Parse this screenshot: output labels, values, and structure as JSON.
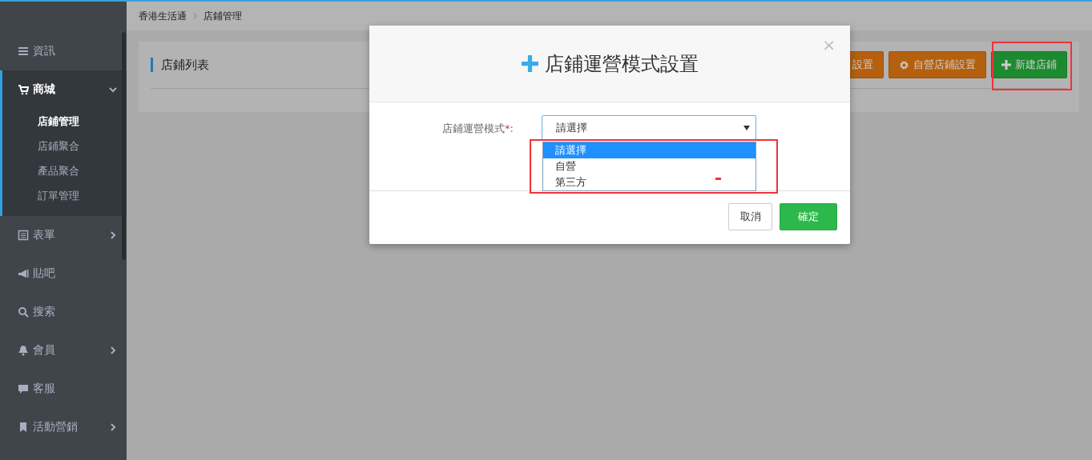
{
  "sidebar": {
    "items": [
      {
        "label": "資訊",
        "selected": false
      },
      {
        "label": "商城",
        "selected": true,
        "expanded": true,
        "children": [
          {
            "label": "店鋪管理",
            "selected": true
          },
          {
            "label": "店鋪聚合",
            "selected": false
          },
          {
            "label": "產品聚合",
            "selected": false
          },
          {
            "label": "訂單管理",
            "selected": false
          }
        ]
      },
      {
        "label": "表單",
        "selected": false,
        "expanded": false
      },
      {
        "label": "貼吧",
        "selected": false
      },
      {
        "label": "搜索",
        "selected": false
      },
      {
        "label": "會員",
        "selected": false,
        "expanded": false
      },
      {
        "label": "客服",
        "selected": false
      },
      {
        "label": "活動營銷",
        "selected": false,
        "expanded": false
      }
    ]
  },
  "breadcrumb": [
    {
      "label": "香港生活通"
    },
    {
      "label": "店鋪管理"
    }
  ],
  "card": {
    "title": "店鋪列表",
    "buttons": [
      {
        "label": "設置",
        "kind": "warning"
      },
      {
        "label": "自營店鋪設置",
        "kind": "warning"
      },
      {
        "label": "新建店鋪",
        "kind": "success"
      }
    ]
  },
  "modal": {
    "title": "店鋪運營模式設置",
    "close": "×",
    "field": {
      "label": "店鋪運營模式",
      "required_mark": "*",
      "suffix": ":",
      "value": "請選擇",
      "expanded": true,
      "options": [
        {
          "label": "請選擇",
          "selected": true
        },
        {
          "label": "自營",
          "selected": false
        },
        {
          "label": "第三方",
          "selected": false
        }
      ]
    },
    "buttons": [
      {
        "label": "取消",
        "kind": "default"
      },
      {
        "label": "確定",
        "kind": "success"
      }
    ]
  }
}
